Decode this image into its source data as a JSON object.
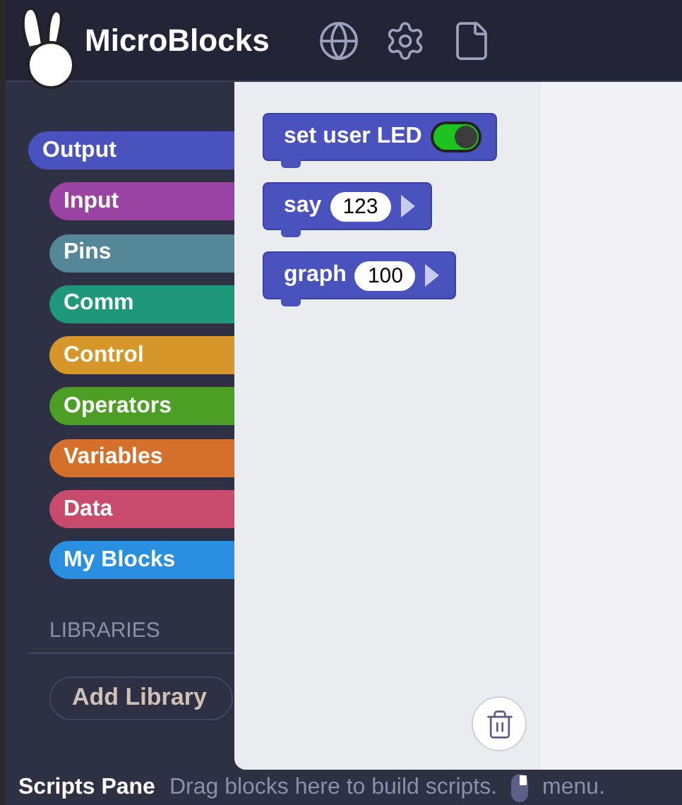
{
  "app": {
    "title": "MicroBlocks"
  },
  "categories": [
    {
      "label": "Output",
      "color": "#4a52bd",
      "selected": true
    },
    {
      "label": "Input",
      "color": "#9b43a3",
      "selected": false
    },
    {
      "label": "Pins",
      "color": "#548798",
      "selected": false
    },
    {
      "label": "Comm",
      "color": "#1f977a",
      "selected": false
    },
    {
      "label": "Control",
      "color": "#d6962a",
      "selected": false
    },
    {
      "label": "Operators",
      "color": "#4c9f24",
      "selected": false
    },
    {
      "label": "Variables",
      "color": "#d4702b",
      "selected": false
    },
    {
      "label": "Data",
      "color": "#c84a6c",
      "selected": false
    },
    {
      "label": "My Blocks",
      "color": "#2a8fe0",
      "selected": false
    }
  ],
  "libraries": {
    "heading": "LIBRARIES",
    "button": "Add Library"
  },
  "blocks": [
    {
      "kind": "toggle",
      "label": "set user LED",
      "on": true
    },
    {
      "kind": "input",
      "label": "say",
      "value": "123"
    },
    {
      "kind": "input",
      "label": "graph",
      "value": "100"
    }
  ],
  "status_bar": {
    "title": "Scripts Pane",
    "hint": "Drag blocks here to build scripts.",
    "menu": "menu."
  }
}
